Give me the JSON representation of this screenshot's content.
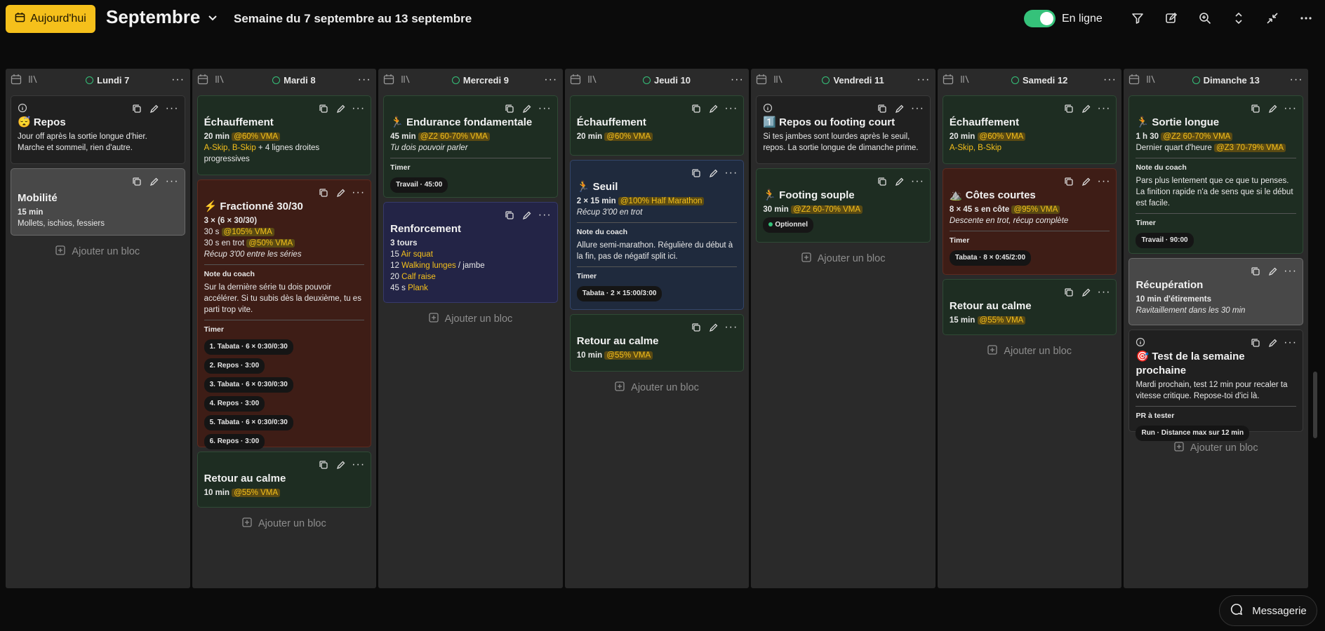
{
  "header": {
    "today_label": "Aujourd'hui",
    "month": "Septembre",
    "week": "Semaine du 7 septembre au 13 septembre",
    "online_label": "En ligne"
  },
  "add_block": "Ajouter un bloc",
  "messages_label": "Messagerie",
  "colors": {
    "accent": "#f5c01b",
    "online": "#35c27a"
  },
  "icons": [
    "calendar-icon",
    "chevron-down-icon",
    "filter-icon",
    "edit-square-icon",
    "zoom-in-icon",
    "expand-vertical-icon",
    "collapse-icon",
    "more-icon",
    "copy-icon",
    "pencil-icon",
    "info-icon",
    "library-icon",
    "plus-square-icon",
    "chat-icon"
  ],
  "days": [
    {
      "title": "Lundi 7",
      "cards": [
        {
          "title": "😴 Repos",
          "line1": "Jour off après la sortie longue d'hier.",
          "line2": "Marche et sommeil, rien d'autre."
        },
        {
          "title": "Mobilité",
          "duration": "15 min",
          "desc": "Mollets, ischios, fessiers"
        }
      ]
    },
    {
      "title": "Mardi 8",
      "cards": [
        {
          "title": "Échauffement",
          "duration": "20 min",
          "intensity": "@60% VMA",
          "drills": "A-Skip, B-Skip",
          "drills_rest": " + 4 lignes droites progressives"
        },
        {
          "title": "⚡ Fractionné 30/30",
          "sets": "3 × (6 × 30/30)",
          "r1a": "30 s",
          "r1b": "@105% VMA",
          "r2a": "30 s en trot",
          "r2b": "@50% VMA",
          "recovery": "Récup 3'00 entre les séries",
          "coach_label": "Note du coach",
          "coach": "Sur la dernière série tu dois pouvoir accélérer. Si tu subis dès la deuxième, tu es parti trop vite.",
          "timer_label": "Timer",
          "timers": [
            "1. Tabata · 6 × 0:30/0:30",
            "2. Repos · 3:00",
            "3. Tabata · 6 × 0:30/0:30",
            "4. Repos · 3:00",
            "5. Tabata · 6 × 0:30/0:30",
            "6. Repos · 3:00"
          ]
        },
        {
          "title": "Retour au calme",
          "duration": "10 min",
          "intensity": "@55% VMA"
        }
      ]
    },
    {
      "title": "Mercredi 9",
      "cards": [
        {
          "title": "🏃 Endurance fondamentale",
          "duration": "45 min",
          "intensity": "@Z2 60-70% VMA",
          "note": "Tu dois pouvoir parler",
          "timer_label": "Timer",
          "timer": "Travail · 45:00"
        },
        {
          "title": "Renforcement",
          "rounds": "3 tours",
          "ex": [
            {
              "n": "15",
              "name": "Air squat",
              "s": ""
            },
            {
              "n": "12",
              "name": "Walking lunges",
              "s": " / jambe"
            },
            {
              "n": "20",
              "name": "Calf raise",
              "s": ""
            },
            {
              "n": "45 s",
              "name": "Plank",
              "s": ""
            }
          ]
        }
      ]
    },
    {
      "title": "Jeudi 10",
      "cards": [
        {
          "title": "Échauffement",
          "duration": "20 min",
          "intensity": "@60% VMA"
        },
        {
          "title": "🏃 Seuil",
          "sets": "2 × 15 min",
          "intensity": "@100% Half Marathon",
          "recovery": "Récup 3'00 en trot",
          "coach_label": "Note du coach",
          "coach": "Allure semi-marathon. Régulière du début à la fin, pas de négatif split ici.",
          "timer_label": "Timer",
          "timer": "Tabata · 2 × 15:00/3:00"
        },
        {
          "title": "Retour au calme",
          "duration": "10 min",
          "intensity": "@55% VMA"
        }
      ]
    },
    {
      "title": "Vendredi 11",
      "cards": [
        {
          "title": "1️⃣ Repos ou footing court",
          "line1": "Si tes jambes sont lourdes après le seuil,",
          "line2": "repos. La sortie longue de dimanche prime."
        },
        {
          "title": "🏃 Footing souple",
          "duration": "30 min",
          "intensity": "@Z2 60-70% VMA",
          "badge": "Optionnel"
        }
      ]
    },
    {
      "title": "Samedi 12",
      "cards": [
        {
          "title": "Échauffement",
          "duration": "20 min",
          "intensity": "@60% VMA",
          "drills": "A-Skip, B-Skip"
        },
        {
          "title": "⛰️ Côtes courtes",
          "sets": "8 × 45 s en côte",
          "intensity": "@95% VMA",
          "note": "Descente en trot, récup complète",
          "timer_label": "Timer",
          "timer": "Tabata · 8 × 0:45/2:00"
        },
        {
          "title": "Retour au calme",
          "duration": "15 min",
          "intensity": "@55% VMA"
        }
      ]
    },
    {
      "title": "Dimanche 13",
      "cards": [
        {
          "title": "🏃 Sortie longue",
          "duration": "1 h 30",
          "intensity": "@Z2 60-70% VMA",
          "last": "Dernier quart d'heure",
          "last_int": "@Z3 70-79% VMA",
          "coach_label": "Note du coach",
          "coach": "Pars plus lentement que ce que tu penses. La finition rapide n'a de sens que si le début est facile.",
          "timer_label": "Timer",
          "timer": "Travail · 90:00"
        },
        {
          "title": "Récupération",
          "detail": "10 min d'étirements",
          "note": "Ravitaillement dans les 30 min"
        },
        {
          "title": "🎯 Test de la semaine prochaine",
          "line1": "Mardi prochain, test 12 min pour recaler ta vitesse critique. Repose-toi d'ici là.",
          "pr_label": "PR à tester",
          "pr": "Run · Distance max sur 12 min"
        }
      ]
    }
  ]
}
